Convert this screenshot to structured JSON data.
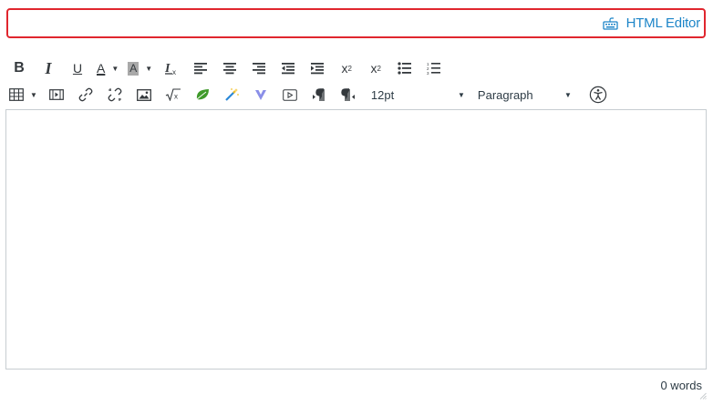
{
  "top_bar": {
    "html_editor_label": "HTML Editor",
    "icon": "keyboard-icon",
    "border_color": "#e0262e",
    "link_color": "#1d85c8"
  },
  "toolbar": {
    "row1": [
      {
        "name": "bold",
        "glyph": "B"
      },
      {
        "name": "italic",
        "glyph": "I"
      },
      {
        "name": "underline",
        "glyph": "U"
      },
      {
        "name": "text-color",
        "glyph": "A"
      },
      {
        "name": "background-color",
        "glyph": "A"
      },
      {
        "name": "clear-formatting",
        "glyph": "Ix"
      },
      {
        "name": "align-left"
      },
      {
        "name": "align-center"
      },
      {
        "name": "align-right"
      },
      {
        "name": "outdent"
      },
      {
        "name": "indent"
      },
      {
        "name": "superscript",
        "glyph": "x"
      },
      {
        "name": "subscript",
        "glyph": "x"
      },
      {
        "name": "bullet-list"
      },
      {
        "name": "numbered-list"
      }
    ],
    "row2": [
      {
        "name": "table"
      },
      {
        "name": "media"
      },
      {
        "name": "link"
      },
      {
        "name": "unlink"
      },
      {
        "name": "image"
      },
      {
        "name": "equation"
      },
      {
        "name": "leaf-plugin"
      },
      {
        "name": "magic-wand"
      },
      {
        "name": "v-plugin"
      },
      {
        "name": "embed-video"
      },
      {
        "name": "ltr-paragraph"
      },
      {
        "name": "rtl-paragraph"
      }
    ],
    "font_size": "12pt",
    "block_format": "Paragraph"
  },
  "editor": {
    "content": ""
  },
  "status_bar": {
    "word_count": "0 words"
  }
}
